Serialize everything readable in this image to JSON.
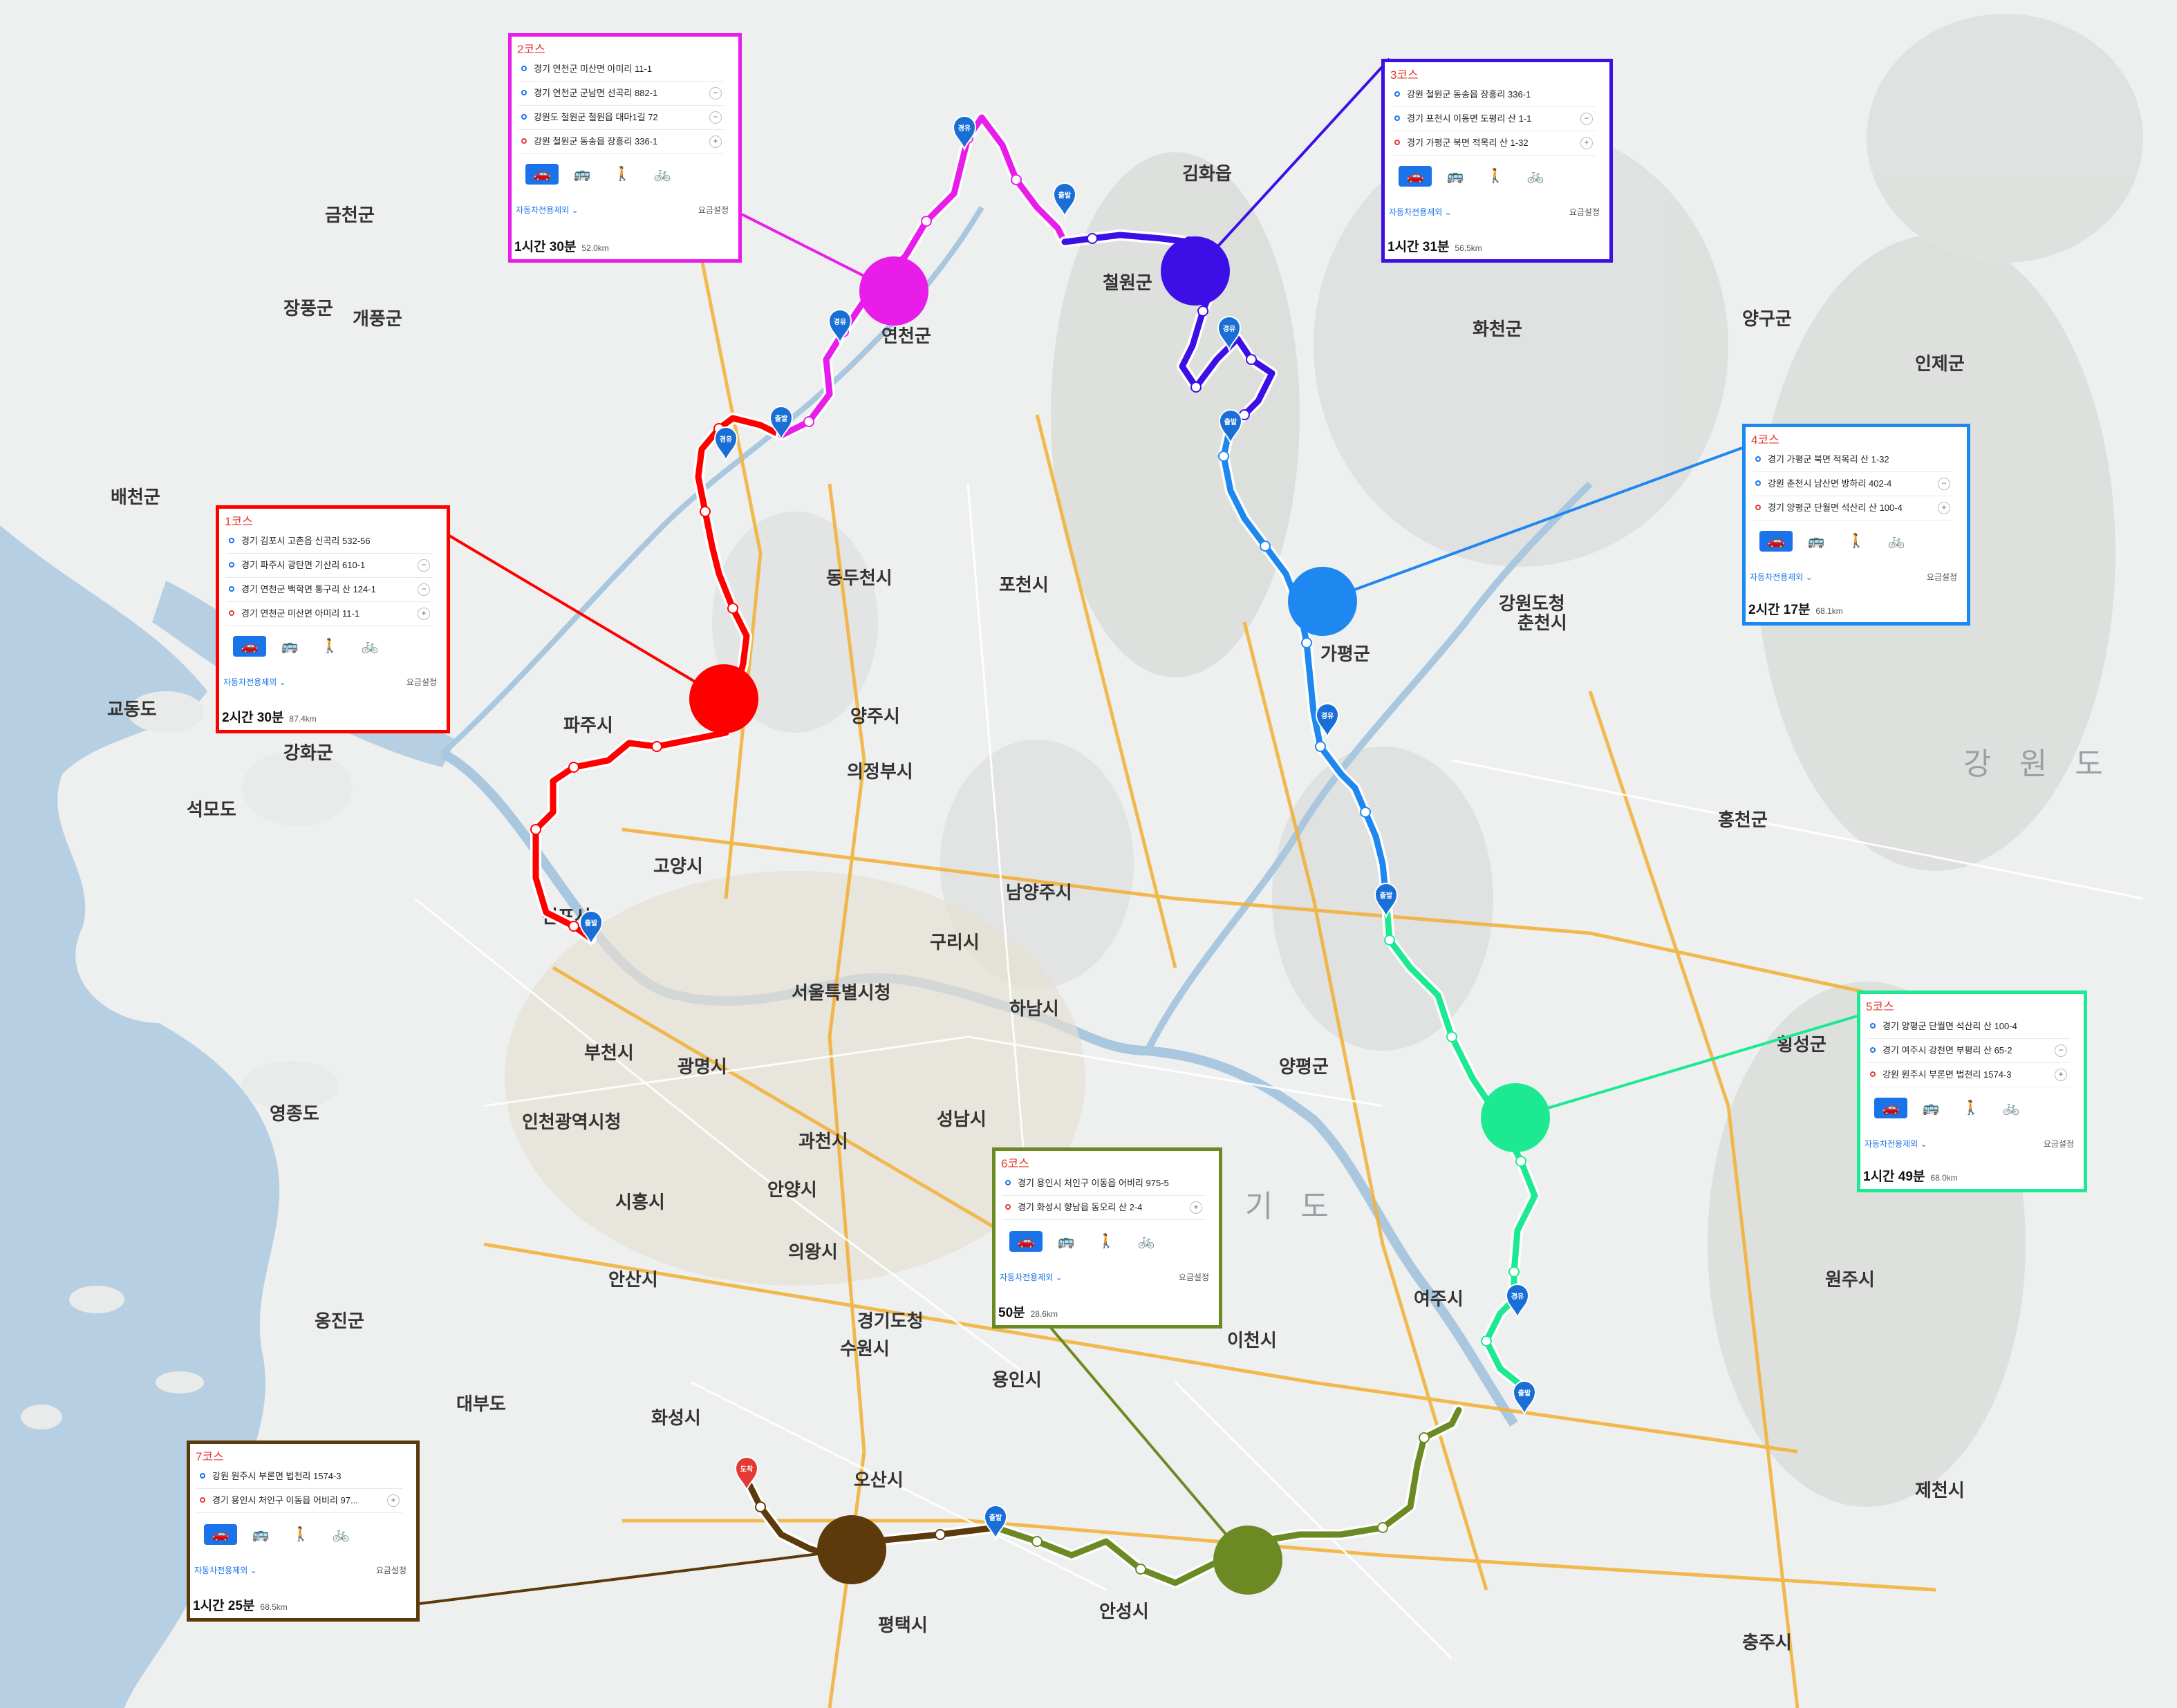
{
  "map": {
    "region_label": "경 기 도",
    "region_label_east": "강 원 도",
    "places": [
      {
        "id": "seoul",
        "name": "서울특별시청"
      },
      {
        "id": "incheon",
        "name": "인천광역시청"
      },
      {
        "id": "gyeonggi",
        "name": "경기도청"
      },
      {
        "id": "gangwon",
        "name": "강원도청"
      },
      {
        "id": "chuncheon",
        "name": "춘천시"
      },
      {
        "id": "pocheon",
        "name": "포천시"
      },
      {
        "id": "yangju",
        "name": "양주시"
      },
      {
        "id": "uijeongbu",
        "name": "의정부시"
      },
      {
        "id": "dongducheon",
        "name": "동두천시"
      },
      {
        "id": "yeoncheon",
        "name": "연천군"
      },
      {
        "id": "cheorwon",
        "name": "철원군"
      },
      {
        "id": "gapyeong",
        "name": "가평군"
      },
      {
        "id": "paju",
        "name": "파주시"
      },
      {
        "id": "goyang",
        "name": "고양시"
      },
      {
        "id": "gimpo",
        "name": "김포시"
      },
      {
        "id": "ganghwa",
        "name": "강화군"
      },
      {
        "id": "bucheon",
        "name": "부천시"
      },
      {
        "id": "gwangmyeong",
        "name": "광명시"
      },
      {
        "id": "anyang",
        "name": "안양시"
      },
      {
        "id": "gwacheon",
        "name": "과천시"
      },
      {
        "id": "siheung",
        "name": "시흥시"
      },
      {
        "id": "ansan",
        "name": "안산시"
      },
      {
        "id": "suwon",
        "name": "수원시"
      },
      {
        "id": "hwaseong",
        "name": "화성시"
      },
      {
        "id": "osan",
        "name": "오산시"
      },
      {
        "id": "pyeongtaek",
        "name": "평택시"
      },
      {
        "id": "anseong",
        "name": "안성시"
      },
      {
        "id": "yongin",
        "name": "용인시"
      },
      {
        "id": "icheon",
        "name": "이천시"
      },
      {
        "id": "yeoju",
        "name": "여주시"
      },
      {
        "id": "wonju",
        "name": "원주시"
      },
      {
        "id": "yangpyeong",
        "name": "양평군"
      },
      {
        "id": "namyangju",
        "name": "남양주시"
      },
      {
        "id": "guri",
        "name": "구리시"
      },
      {
        "id": "hanam",
        "name": "하남시"
      },
      {
        "id": "seongnam",
        "name": "성남시"
      },
      {
        "id": "hongcheon",
        "name": "홍천군"
      },
      {
        "id": "hoengseong",
        "name": "횡성군"
      },
      {
        "id": "jecheon",
        "name": "제천시"
      },
      {
        "id": "chungju",
        "name": "충주시"
      },
      {
        "id": "uiwang",
        "name": "의왕시"
      },
      {
        "id": "hwacheon",
        "name": "화천군"
      },
      {
        "id": "yanggu",
        "name": "양구군"
      },
      {
        "id": "inje",
        "name": "인제군"
      },
      {
        "id": "gimhwa",
        "name": "김화읍"
      },
      {
        "id": "gyodong",
        "name": "교동도"
      },
      {
        "id": "baecheon",
        "name": "배천군"
      },
      {
        "id": "yeongjong",
        "name": "영종도"
      },
      {
        "id": "ongjin",
        "name": "옹진군"
      },
      {
        "id": "daebudo",
        "name": "대부도"
      },
      {
        "id": "seogdo",
        "name": "석모도"
      },
      {
        "id": "jangpung",
        "name": "장풍군"
      },
      {
        "id": "gaepung",
        "name": "개풍군"
      },
      {
        "id": "geumcheon",
        "name": "금천군"
      }
    ],
    "markers": {
      "start": "출발",
      "via": "경유",
      "end": "도착"
    }
  },
  "courses": [
    {
      "id": "c1",
      "title": "1코스",
      "color": "#ff0000",
      "stops": [
        "경기 김포시 고촌읍 신곡리 532-56",
        "경기 파주시 광탄면 기산리 610-1",
        "경기 연천군 백학면 통구리 산 124-1",
        "경기 연천군 미산면 아미리 11-1"
      ],
      "time": "2시간 30분",
      "distance": "87.4km"
    },
    {
      "id": "c2",
      "title": "2코스",
      "color": "#e91de9",
      "stops": [
        "경기 연천군 미산면 아미리 11-1",
        "경기 연천군 군남면 선곡리 882-1",
        "강원도 철원군 철원읍 대마1길 72",
        "강원 철원군 동송읍 장흥리 336-1"
      ],
      "time": "1시간 30분",
      "distance": "52.0km"
    },
    {
      "id": "c3",
      "title": "3코스",
      "color": "#3d0fe6",
      "stops": [
        "강원 철원군 동송읍 장흥리 336-1",
        "경기 포천시 이동면 도평리 산 1-1",
        "경기 가평군 북면 적목리 산 1-32"
      ],
      "time": "1시간 31분",
      "distance": "56.5km"
    },
    {
      "id": "c4",
      "title": "4코스",
      "color": "#1e88f0",
      "stops": [
        "경기 가평군 북면 적목리 산 1-32",
        "강원 춘천시 남산면 방하리 402-4",
        "경기 양평군 단월면 석산리 산 100-4"
      ],
      "time": "2시간 17분",
      "distance": "68.1km"
    },
    {
      "id": "c5",
      "title": "5코스",
      "color": "#1de992",
      "stops": [
        "경기 양평군 단월면 석산리 산 100-4",
        "경기 여주시 강천면 부평리 산 65-2",
        "강원 원주시 부론면 법천리 1574-3"
      ],
      "time": "1시간 49분",
      "distance": "68.0km"
    },
    {
      "id": "c6",
      "title": "6코스",
      "color": "#6b8a23",
      "stops": [
        "경기 용인시 처인구 이동읍 어비리 975-5",
        "경기 화성시 향남읍 동오리 산 2-4"
      ],
      "time": "50분",
      "distance": "28.6km"
    },
    {
      "id": "c7",
      "title": "7코스",
      "color": "#5c3a0c",
      "stops": [
        "강원 원주시 부론면 법천리 1574-3",
        "경기 용인시 처인구 이동읍 어비리 97..."
      ],
      "time": "1시간 25분",
      "distance": "68.5km"
    }
  ],
  "panel_ui": {
    "options_label": "자동차전용제외 ⌄",
    "fare_label": "요금설정",
    "modes": [
      {
        "icon": "car-icon",
        "glyph": "🚗"
      },
      {
        "icon": "bus-icon",
        "glyph": "🚌"
      },
      {
        "icon": "walk-icon",
        "glyph": "🚶"
      },
      {
        "icon": "bike-icon",
        "glyph": "🚲"
      }
    ]
  }
}
